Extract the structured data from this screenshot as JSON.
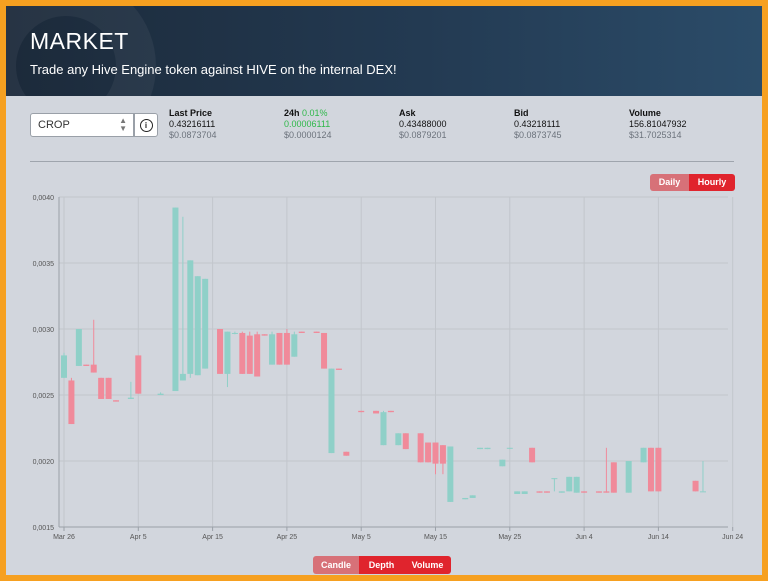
{
  "header": {
    "title": "MARKET",
    "subtitle": "Trade any Hive Engine token against HIVE on the internal DEX!"
  },
  "token_select": {
    "value": "CROP"
  },
  "stats": {
    "last_price": {
      "label": "Last Price",
      "value": "0.43216111",
      "usd": "$0.0873704"
    },
    "change_24h": {
      "label": "24h",
      "percent": "0.01%",
      "value": "0.00006111",
      "usd": "$0.0000124"
    },
    "ask": {
      "label": "Ask",
      "value": "0.43488000",
      "usd": "$0.0879201"
    },
    "bid": {
      "label": "Bid",
      "value": "0.43218111",
      "usd": "$0.0873745"
    },
    "volume": {
      "label": "Volume",
      "value": "156.81047932",
      "usd": "$31.7025314"
    }
  },
  "interval_toggle": {
    "daily": "Daily",
    "hourly": "Hourly",
    "selected": "Hourly"
  },
  "chart_tabs": {
    "candle": "Candle",
    "depth": "Depth",
    "volume": "Volume",
    "selected": "Candle"
  },
  "colors": {
    "up": "#8fd0c8",
    "down": "#f08a9a",
    "accent_red": "#e0242d",
    "page_border": "#f6a020"
  },
  "chart_data": {
    "type": "candlestick",
    "y_ticks": [
      "0,0040",
      "0,0035",
      "0,0030",
      "0,0025",
      "0,0020",
      "0,0015"
    ],
    "ylim": [
      0.0015,
      0.004
    ],
    "x_ticks": [
      "Mar 26",
      "Apr 5",
      "Apr 15",
      "Apr 25",
      "May 5",
      "May 15",
      "May 25",
      "Jun 4",
      "Jun 14",
      "Jun 24"
    ],
    "x_start": "2021-03-26",
    "grid": true,
    "candles": [
      {
        "d": 0,
        "o": 0.00263,
        "h": 0.00282,
        "l": 0.00263,
        "c": 0.0028
      },
      {
        "d": 1,
        "o": 0.00261,
        "h": 0.00263,
        "l": 0.00228,
        "c": 0.00228
      },
      {
        "d": 2,
        "o": 0.00272,
        "h": 0.003,
        "l": 0.00272,
        "c": 0.003
      },
      {
        "d": 3,
        "o": 0.00273,
        "h": 0.00273,
        "l": 0.00272,
        "c": 0.00272
      },
      {
        "d": 4,
        "o": 0.00273,
        "h": 0.00307,
        "l": 0.00267,
        "c": 0.00267
      },
      {
        "d": 5,
        "o": 0.00263,
        "h": 0.00263,
        "l": 0.00247,
        "c": 0.00247
      },
      {
        "d": 6,
        "o": 0.00263,
        "h": 0.00263,
        "l": 0.00247,
        "c": 0.00247
      },
      {
        "d": 7,
        "o": 0.00246,
        "h": 0.00246,
        "l": 0.00245,
        "c": 0.00245
      },
      {
        "d": 9,
        "o": 0.00247,
        "h": 0.0026,
        "l": 0.00247,
        "c": 0.00248
      },
      {
        "d": 10,
        "o": 0.0028,
        "h": 0.0028,
        "l": 0.00251,
        "c": 0.00251
      },
      {
        "d": 13,
        "o": 0.0025,
        "h": 0.00252,
        "l": 0.0025,
        "c": 0.00251
      },
      {
        "d": 15,
        "o": 0.00253,
        "h": 0.00392,
        "l": 0.00253,
        "c": 0.00392
      },
      {
        "d": 16,
        "o": 0.00261,
        "h": 0.00385,
        "l": 0.00261,
        "c": 0.00266
      },
      {
        "d": 17,
        "o": 0.00266,
        "h": 0.00352,
        "l": 0.00263,
        "c": 0.00352
      },
      {
        "d": 18,
        "o": 0.00265,
        "h": 0.0034,
        "l": 0.00265,
        "c": 0.0034
      },
      {
        "d": 19,
        "o": 0.0027,
        "h": 0.00338,
        "l": 0.0027,
        "c": 0.00338
      },
      {
        "d": 21,
        "o": 0.003,
        "h": 0.003,
        "l": 0.00266,
        "c": 0.00266
      },
      {
        "d": 22,
        "o": 0.00266,
        "h": 0.00298,
        "l": 0.00256,
        "c": 0.00298
      },
      {
        "d": 23,
        "o": 0.00297,
        "h": 0.00298,
        "l": 0.00296,
        "c": 0.00297
      },
      {
        "d": 24,
        "o": 0.00297,
        "h": 0.00298,
        "l": 0.00266,
        "c": 0.00266
      },
      {
        "d": 25,
        "o": 0.00295,
        "h": 0.00298,
        "l": 0.00266,
        "c": 0.00266
      },
      {
        "d": 26,
        "o": 0.00296,
        "h": 0.00298,
        "l": 0.00264,
        "c": 0.00264
      },
      {
        "d": 27,
        "o": 0.00296,
        "h": 0.00296,
        "l": 0.00295,
        "c": 0.00295
      },
      {
        "d": 28,
        "o": 0.00273,
        "h": 0.00298,
        "l": 0.00273,
        "c": 0.00296
      },
      {
        "d": 29,
        "o": 0.00297,
        "h": 0.00297,
        "l": 0.00273,
        "c": 0.00273
      },
      {
        "d": 30,
        "o": 0.00297,
        "h": 0.003,
        "l": 0.00273,
        "c": 0.00273
      },
      {
        "d": 31,
        "o": 0.00279,
        "h": 0.00298,
        "l": 0.00279,
        "c": 0.00296
      },
      {
        "d": 32,
        "o": 0.00298,
        "h": 0.00298,
        "l": 0.00297,
        "c": 0.00297
      },
      {
        "d": 34,
        "o": 0.00298,
        "h": 0.00298,
        "l": 0.00297,
        "c": 0.00297
      },
      {
        "d": 35,
        "o": 0.00297,
        "h": 0.00297,
        "l": 0.0027,
        "c": 0.0027
      },
      {
        "d": 36,
        "o": 0.00206,
        "h": 0.0027,
        "l": 0.00206,
        "c": 0.0027
      },
      {
        "d": 37,
        "o": 0.0027,
        "h": 0.0027,
        "l": 0.00269,
        "c": 0.00269
      },
      {
        "d": 38,
        "o": 0.00207,
        "h": 0.00207,
        "l": 0.00204,
        "c": 0.00204
      },
      {
        "d": 40,
        "o": 0.00238,
        "h": 0.00238,
        "l": 0.00237,
        "c": 0.00237
      },
      {
        "d": 42,
        "o": 0.00238,
        "h": 0.00238,
        "l": 0.00236,
        "c": 0.00236
      },
      {
        "d": 43,
        "o": 0.00212,
        "h": 0.00238,
        "l": 0.00212,
        "c": 0.00237
      },
      {
        "d": 44,
        "o": 0.00238,
        "h": 0.00238,
        "l": 0.00237,
        "c": 0.00237
      },
      {
        "d": 45,
        "o": 0.00212,
        "h": 0.00221,
        "l": 0.00212,
        "c": 0.00221
      },
      {
        "d": 46,
        "o": 0.00221,
        "h": 0.00221,
        "l": 0.00209,
        "c": 0.00209
      },
      {
        "d": 48,
        "o": 0.00221,
        "h": 0.00221,
        "l": 0.00199,
        "c": 0.00199
      },
      {
        "d": 49,
        "o": 0.00214,
        "h": 0.00214,
        "l": 0.00199,
        "c": 0.00199
      },
      {
        "d": 50,
        "o": 0.00214,
        "h": 0.00214,
        "l": 0.0019,
        "c": 0.00198
      },
      {
        "d": 51,
        "o": 0.00212,
        "h": 0.00212,
        "l": 0.0019,
        "c": 0.00198
      },
      {
        "d": 52,
        "o": 0.00169,
        "h": 0.00211,
        "l": 0.00169,
        "c": 0.00211
      },
      {
        "d": 54,
        "o": 0.00171,
        "h": 0.00172,
        "l": 0.00171,
        "c": 0.00172
      },
      {
        "d": 55,
        "o": 0.00172,
        "h": 0.00174,
        "l": 0.00172,
        "c": 0.00174
      },
      {
        "d": 56,
        "o": 0.00209,
        "h": 0.0021,
        "l": 0.00209,
        "c": 0.0021
      },
      {
        "d": 57,
        "o": 0.00209,
        "h": 0.0021,
        "l": 0.00209,
        "c": 0.0021
      },
      {
        "d": 59,
        "o": 0.00196,
        "h": 0.00201,
        "l": 0.00196,
        "c": 0.00201
      },
      {
        "d": 60,
        "o": 0.0021,
        "h": 0.0021,
        "l": 0.00209,
        "c": 0.0021
      },
      {
        "d": 61,
        "o": 0.00175,
        "h": 0.00177,
        "l": 0.00175,
        "c": 0.00177
      },
      {
        "d": 62,
        "o": 0.00175,
        "h": 0.00177,
        "l": 0.00175,
        "c": 0.00177
      },
      {
        "d": 63,
        "o": 0.0021,
        "h": 0.0021,
        "l": 0.00199,
        "c": 0.00199
      },
      {
        "d": 64,
        "o": 0.00177,
        "h": 0.00177,
        "l": 0.00176,
        "c": 0.00176
      },
      {
        "d": 65,
        "o": 0.00177,
        "h": 0.00177,
        "l": 0.00176,
        "c": 0.00176
      },
      {
        "d": 66,
        "o": 0.00187,
        "h": 0.00187,
        "l": 0.00177,
        "c": 0.00187
      },
      {
        "d": 67,
        "o": 0.00176,
        "h": 0.00177,
        "l": 0.00176,
        "c": 0.00177
      },
      {
        "d": 68,
        "o": 0.00177,
        "h": 0.00188,
        "l": 0.00177,
        "c": 0.00188
      },
      {
        "d": 69,
        "o": 0.00176,
        "h": 0.00188,
        "l": 0.00176,
        "c": 0.00188
      },
      {
        "d": 70,
        "o": 0.00177,
        "h": 0.00177,
        "l": 0.00176,
        "c": 0.00176
      },
      {
        "d": 72,
        "o": 0.00177,
        "h": 0.00177,
        "l": 0.00176,
        "c": 0.00176
      },
      {
        "d": 73,
        "o": 0.00177,
        "h": 0.0021,
        "l": 0.00176,
        "c": 0.00176
      },
      {
        "d": 74,
        "o": 0.00199,
        "h": 0.00199,
        "l": 0.00176,
        "c": 0.00176
      },
      {
        "d": 76,
        "o": 0.00176,
        "h": 0.002,
        "l": 0.00176,
        "c": 0.002
      },
      {
        "d": 78,
        "o": 0.00199,
        "h": 0.0021,
        "l": 0.00199,
        "c": 0.0021
      },
      {
        "d": 79,
        "o": 0.0021,
        "h": 0.0021,
        "l": 0.00177,
        "c": 0.00177
      },
      {
        "d": 80,
        "o": 0.0021,
        "h": 0.0021,
        "l": 0.00177,
        "c": 0.00177
      },
      {
        "d": 85,
        "o": 0.00185,
        "h": 0.00185,
        "l": 0.00177,
        "c": 0.00177
      },
      {
        "d": 86,
        "o": 0.00177,
        "h": 0.002,
        "l": 0.00177,
        "c": 0.00177
      }
    ]
  }
}
